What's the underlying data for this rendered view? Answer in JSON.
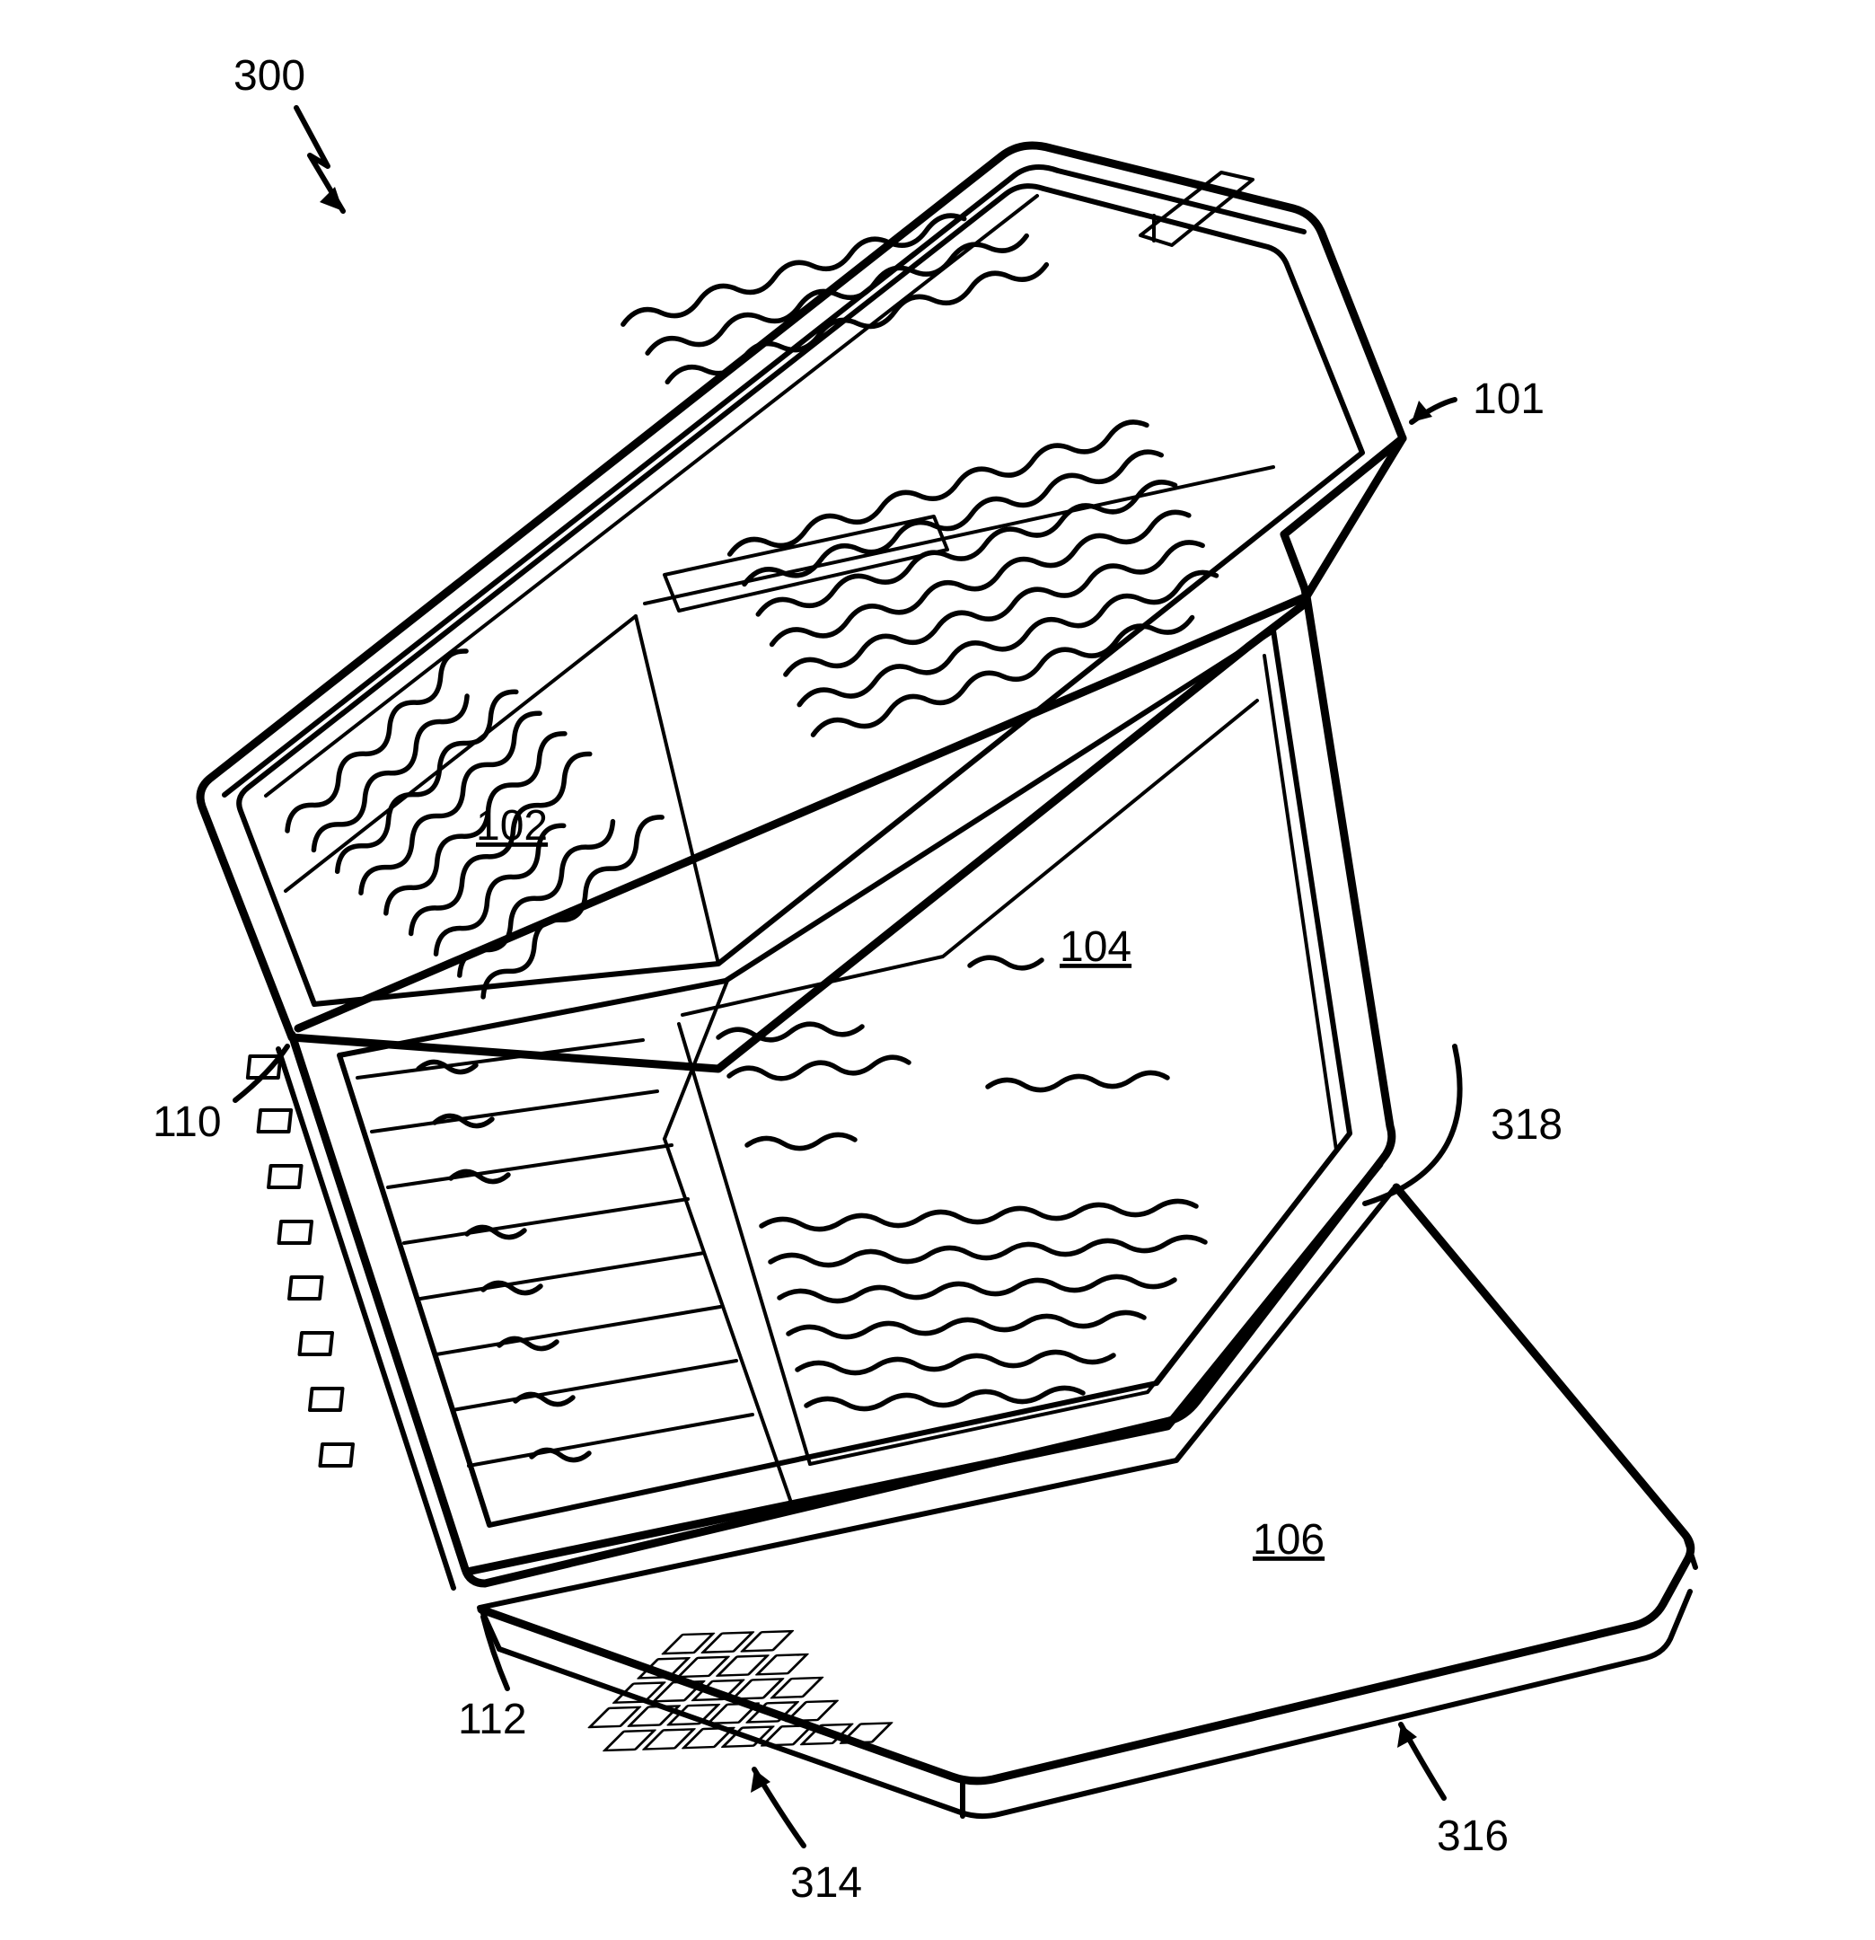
{
  "diagram": {
    "title_ref": "300",
    "callouts": {
      "101": "101",
      "102": "102",
      "104": "104",
      "106": "106",
      "110": "110",
      "112": "112",
      "314": "314",
      "316": "316",
      "318": "318"
    }
  }
}
